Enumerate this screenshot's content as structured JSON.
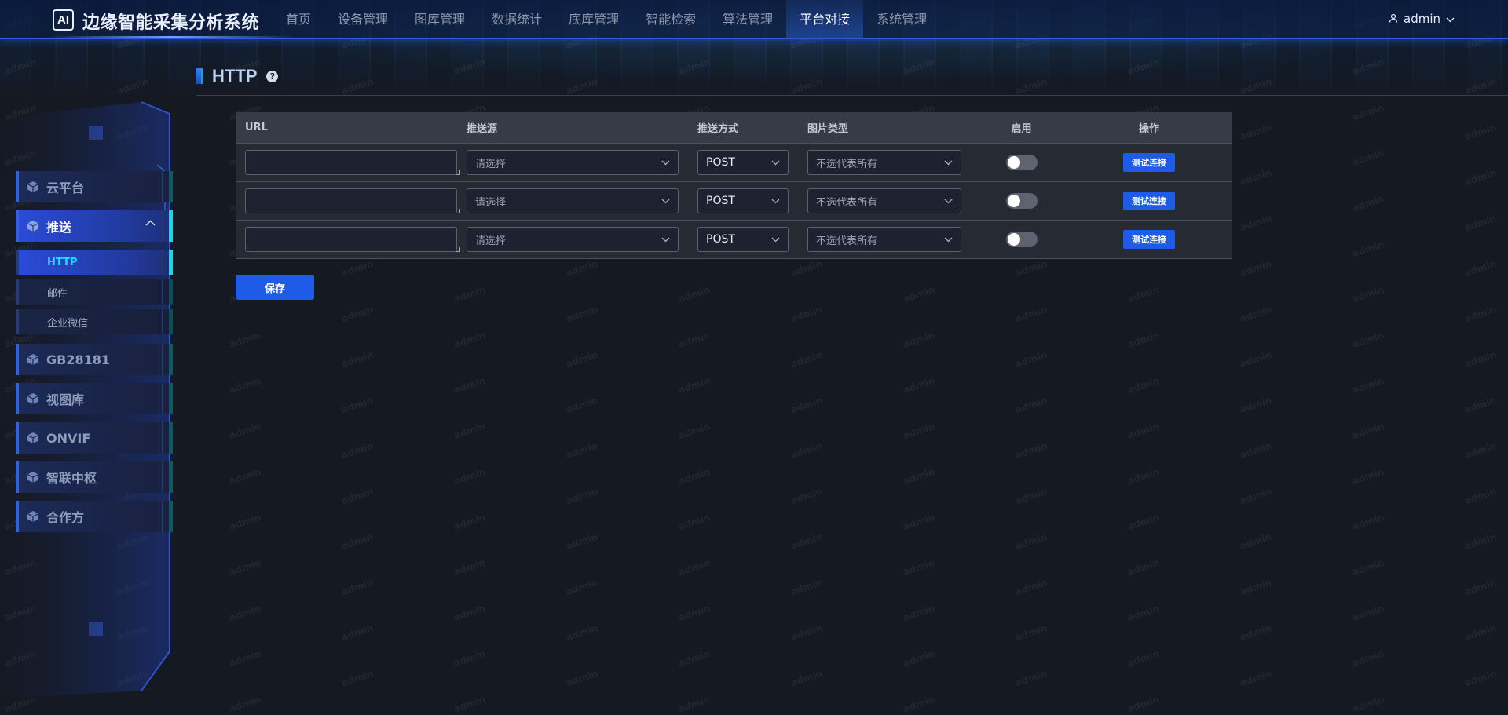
{
  "app": {
    "logo_text": "AI",
    "title": "边缘智能采集分析系统",
    "user": "admin"
  },
  "nav": [
    {
      "label": "首页",
      "active": false
    },
    {
      "label": "设备管理",
      "active": false
    },
    {
      "label": "图库管理",
      "active": false
    },
    {
      "label": "数据统计",
      "active": false
    },
    {
      "label": "底库管理",
      "active": false
    },
    {
      "label": "智能检索",
      "active": false
    },
    {
      "label": "算法管理",
      "active": false
    },
    {
      "label": "平台对接",
      "active": true
    },
    {
      "label": "系统管理",
      "active": false
    }
  ],
  "sidebar": {
    "items": [
      {
        "label": "云平台"
      },
      {
        "label": "推送",
        "expanded": true,
        "active": true,
        "children": [
          {
            "label": "HTTP",
            "active": true
          },
          {
            "label": "邮件"
          },
          {
            "label": "企业微信"
          }
        ]
      },
      {
        "label": "GB28181"
      },
      {
        "label": "视图库"
      },
      {
        "label": "ONVIF"
      },
      {
        "label": "智联中枢"
      },
      {
        "label": "合作方"
      }
    ]
  },
  "page": {
    "title": "HTTP",
    "help_icon": "question-circle-icon"
  },
  "table": {
    "headers": {
      "url": "URL",
      "source": "推送源",
      "method": "推送方式",
      "image_type": "图片类型",
      "enabled": "启用",
      "action": "操作"
    },
    "rows": [
      {
        "url": "",
        "source_placeholder": "请选择",
        "method": "POST",
        "image_type": "不选代表所有",
        "enabled": false,
        "action": "测试连接"
      },
      {
        "url": "",
        "source_placeholder": "请选择",
        "method": "POST",
        "image_type": "不选代表所有",
        "enabled": false,
        "action": "测试连接"
      },
      {
        "url": "",
        "source_placeholder": "请选择",
        "method": "POST",
        "image_type": "不选代表所有",
        "enabled": false,
        "action": "测试连接"
      }
    ]
  },
  "save_button": "保存",
  "watermark": "admin",
  "colors": {
    "accent": "#1e5be6",
    "active_cyan": "#19e0ff",
    "background": "#151922"
  }
}
